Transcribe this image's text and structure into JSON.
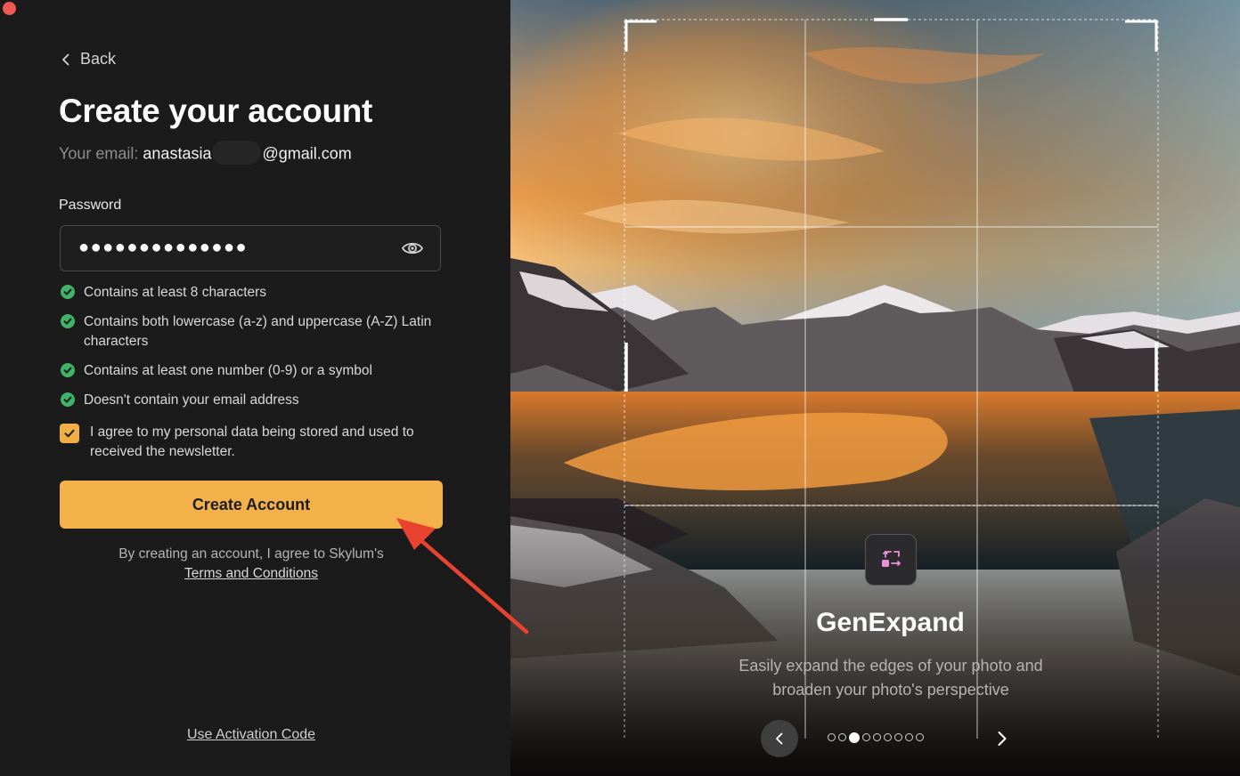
{
  "window": {
    "close_icon": "close-icon"
  },
  "auth": {
    "back_label": "Back",
    "title": "Create your account",
    "email_label": "Your email:",
    "email_user": "anastasia",
    "email_domain": "@gmail.com",
    "password_label": "Password",
    "password_mask": "●●●●●●●●●●●●●●",
    "rules": [
      "Contains at least 8 characters",
      "Contains both lowercase (a-z) and uppercase (A-Z) Latin characters",
      "Contains at least one number (0-9) or a symbol",
      "Doesn't contain your email address"
    ],
    "consent_checked": true,
    "consent_text": "I agree to my personal data being stored and used to received the newsletter.",
    "create_button": "Create Account",
    "terms_prefix": "By creating an account, I agree to Skylum's",
    "terms_link": "Terms and Conditions",
    "activation_link": "Use Activation Code"
  },
  "feature": {
    "icon": "genexpand-icon",
    "title": "GenExpand",
    "description": "Easily expand the edges of your photo and broaden your photo's perspective",
    "slide_count": 9,
    "active_slide": 3
  },
  "colors": {
    "accent": "#f4b049",
    "check_green": "#3fb366",
    "annotation_arrow": "#e8432f"
  }
}
